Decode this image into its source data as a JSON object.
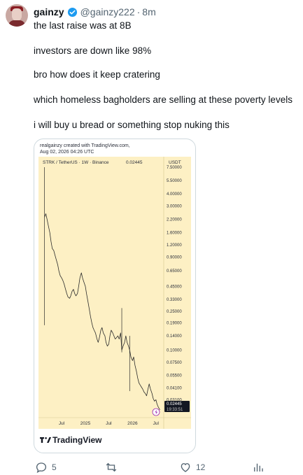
{
  "tweet": {
    "author_name": "gainzy",
    "handle": "@gainzy222",
    "separator": "·",
    "time": "8m",
    "lines": [
      "the last raise was at 8B",
      "investors are down like 98%",
      "bro how does it keep cratering",
      "which homeless bagholders are selling at these poverty levels",
      "i will buy u bread or something stop nuking this"
    ]
  },
  "chart_card": {
    "created_by": "realgainzy created with TradingView.com,",
    "created_at": "Aug 02, 2026 04:26 UTC",
    "brand": "TradingView",
    "colors": {
      "background": "#fdf0c4",
      "line": "#2b2b2b",
      "price_label_bg": "#131722"
    }
  },
  "chart_data": {
    "type": "line",
    "title": "STRK / TetherUS · 1W · Binance",
    "last_value_label": "0.02445",
    "currency": "USDT",
    "y_scale": "log",
    "y_ticks": [
      "7.50000",
      "5.50000",
      "4.00000",
      "3.00000",
      "2.20000",
      "1.60000",
      "1.20000",
      "0.90000",
      "0.65000",
      "0.45000",
      "0.33000",
      "0.25000",
      "0.19000",
      "0.14000",
      "0.10000",
      "0.07500",
      "0.05500",
      "0.04100",
      "0.03100"
    ],
    "x_ticks": [
      "Jul",
      "2025",
      "Jul",
      "2026",
      "Jul"
    ],
    "last_price": "0.02445",
    "countdown": "19:33:51",
    "series": [
      {
        "points": [
          [
            "2024-02-20",
            2.3
          ],
          [
            "2024-03-01",
            2.5
          ],
          [
            "2024-03-10",
            2.2
          ],
          [
            "2024-03-20",
            1.9
          ],
          [
            "2024-04-01",
            1.6
          ],
          [
            "2024-04-10",
            1.3
          ],
          [
            "2024-04-20",
            1.1
          ],
          [
            "2024-05-01",
            1.05
          ],
          [
            "2024-05-10",
            0.95
          ],
          [
            "2024-05-20",
            0.85
          ],
          [
            "2024-06-01",
            0.75
          ],
          [
            "2024-06-10",
            0.65
          ],
          [
            "2024-06-20",
            0.58
          ],
          [
            "2024-07-01",
            0.55
          ],
          [
            "2024-07-10",
            0.52
          ],
          [
            "2024-07-20",
            0.48
          ],
          [
            "2024-08-01",
            0.42
          ],
          [
            "2024-08-10",
            0.38
          ],
          [
            "2024-08-20",
            0.35
          ],
          [
            "2024-09-01",
            0.34
          ],
          [
            "2024-09-10",
            0.36
          ],
          [
            "2024-09-20",
            0.4
          ],
          [
            "2024-10-01",
            0.42
          ],
          [
            "2024-10-10",
            0.38
          ],
          [
            "2024-10-20",
            0.36
          ],
          [
            "2024-11-01",
            0.38
          ],
          [
            "2024-11-10",
            0.45
          ],
          [
            "2024-11-20",
            0.55
          ],
          [
            "2024-12-01",
            0.62
          ],
          [
            "2024-12-10",
            0.55
          ],
          [
            "2024-12-20",
            0.5
          ],
          [
            "2025-01-01",
            0.45
          ],
          [
            "2025-01-10",
            0.38
          ],
          [
            "2025-01-20",
            0.32
          ],
          [
            "2025-02-01",
            0.26
          ],
          [
            "2025-02-10",
            0.22
          ],
          [
            "2025-02-20",
            0.19
          ],
          [
            "2025-03-01",
            0.17
          ],
          [
            "2025-03-10",
            0.16
          ],
          [
            "2025-03-20",
            0.15
          ],
          [
            "2025-04-01",
            0.13
          ],
          [
            "2025-04-10",
            0.12
          ],
          [
            "2025-04-20",
            0.135
          ],
          [
            "2025-05-01",
            0.16
          ],
          [
            "2025-05-10",
            0.17
          ],
          [
            "2025-05-20",
            0.15
          ],
          [
            "2025-06-01",
            0.14
          ],
          [
            "2025-06-10",
            0.12
          ],
          [
            "2025-06-20",
            0.11
          ],
          [
            "2025-07-01",
            0.115
          ],
          [
            "2025-07-10",
            0.14
          ],
          [
            "2025-07-20",
            0.16
          ],
          [
            "2025-08-01",
            0.15
          ],
          [
            "2025-08-10",
            0.14
          ],
          [
            "2025-08-20",
            0.13
          ],
          [
            "2025-09-01",
            0.135
          ],
          [
            "2025-09-10",
            0.14
          ],
          [
            "2025-09-20",
            0.13
          ],
          [
            "2025-10-01",
            0.15
          ],
          [
            "2025-10-10",
            0.1
          ],
          [
            "2025-10-20",
            0.11
          ],
          [
            "2025-11-01",
            0.12
          ],
          [
            "2025-11-10",
            0.14
          ],
          [
            "2025-11-20",
            0.12
          ],
          [
            "2025-12-01",
            0.11
          ],
          [
            "2025-12-10",
            0.1
          ],
          [
            "2025-12-20",
            0.085
          ],
          [
            "2026-01-01",
            0.078
          ],
          [
            "2026-01-10",
            0.085
          ],
          [
            "2026-01-20",
            0.07
          ],
          [
            "2026-02-01",
            0.06
          ],
          [
            "2026-02-10",
            0.052
          ],
          [
            "2026-02-20",
            0.046
          ],
          [
            "2026-03-01",
            0.044
          ],
          [
            "2026-03-10",
            0.042
          ],
          [
            "2026-03-20",
            0.04
          ],
          [
            "2026-04-01",
            0.037
          ],
          [
            "2026-04-10",
            0.036
          ],
          [
            "2026-04-20",
            0.034
          ],
          [
            "2026-05-01",
            0.04
          ],
          [
            "2026-05-10",
            0.045
          ],
          [
            "2026-05-20",
            0.04
          ],
          [
            "2026-06-01",
            0.036
          ],
          [
            "2026-06-10",
            0.032
          ],
          [
            "2026-06-20",
            0.03
          ],
          [
            "2026-07-01",
            0.031
          ],
          [
            "2026-07-10",
            0.028
          ],
          [
            "2026-07-20",
            0.026
          ],
          [
            "2026-08-01",
            0.02445
          ]
        ]
      }
    ],
    "wicks": [
      [
        "2024-02-20",
        0.18,
        7.5
      ],
      [
        "2025-10-10",
        0.095,
        0.27
      ],
      [
        "2025-12-10",
        0.038,
        0.14
      ]
    ]
  },
  "actions": {
    "replies": "5",
    "reposts": "",
    "likes": "12",
    "views": ""
  }
}
